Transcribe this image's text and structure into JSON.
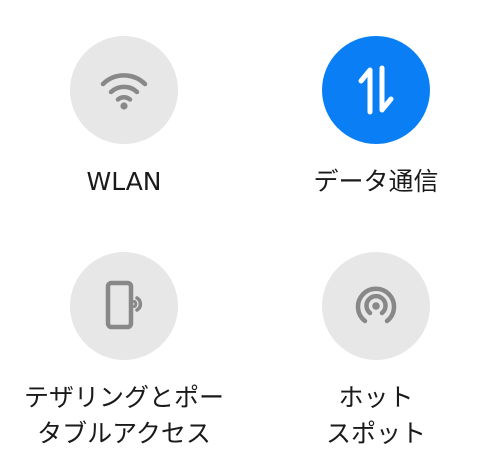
{
  "tiles": [
    {
      "id": "wlan",
      "label": "WLAN",
      "icon": "wifi-icon",
      "state": "off"
    },
    {
      "id": "data",
      "label": "データ通信",
      "icon": "data-transfer-icon",
      "state": "on"
    },
    {
      "id": "tethering",
      "label": "テザリングとポー\nタブルアクセス",
      "icon": "phone-tethering-icon",
      "state": "off"
    },
    {
      "id": "hotspot",
      "label": "ホット\nスポット",
      "icon": "hotspot-icon",
      "state": "off"
    }
  ],
  "colors": {
    "active": "#0a7ff5",
    "inactive_bg": "#e7e7e7",
    "inactive_icon": "#888888",
    "label": "#1a1a1a"
  }
}
